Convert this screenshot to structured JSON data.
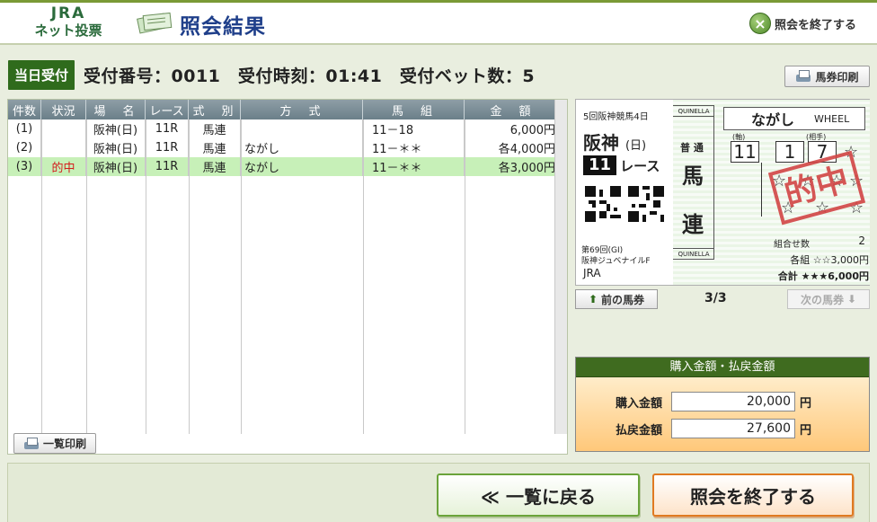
{
  "header": {
    "logo_line1": "JRA",
    "logo_line2": "ネット投票",
    "title": "照会結果",
    "end_label": "照会を終了する"
  },
  "info": {
    "today_badge": "当日受付",
    "text": "受付番号：0011　受付時刻：01:41　受付ベット数：5",
    "ticket_print_label": "馬券印刷"
  },
  "table": {
    "headers": [
      "件数",
      "状況",
      "場　名",
      "レース",
      "式　別",
      "方　式",
      "馬　組",
      "金　額"
    ],
    "rows": [
      {
        "no": "(1)",
        "status": "",
        "venue": "阪神(日)",
        "race": "11R",
        "bet_type": "馬連",
        "method": "",
        "combo": "11－18",
        "amount": "6,000円"
      },
      {
        "no": "(2)",
        "status": "",
        "venue": "阪神(日)",
        "race": "11R",
        "bet_type": "馬連",
        "method": "ながし",
        "combo": "11－＊＊",
        "amount": "各4,000円"
      },
      {
        "no": "(3)",
        "status": "的中",
        "venue": "阪神(日)",
        "race": "11R",
        "bet_type": "馬連",
        "method": "ながし",
        "combo": "11－＊＊",
        "amount": "各3,000円"
      }
    ],
    "list_print_label": "一覧印刷"
  },
  "ticket": {
    "meeting": "5回阪神競馬4日",
    "venue": "阪神",
    "day": "(日)",
    "race_no": "11",
    "race_label": "レース",
    "quinella_top": "QUINELLA",
    "quinella_bottom": "QUINELLA",
    "normal": "普 通",
    "type_char1": "馬",
    "type_char2": "連",
    "method_name": "ながし",
    "method_en": "WHEEL",
    "axis_label": "(軸)",
    "partner_label": "(相手)",
    "axis_no": "11",
    "partner1": "1",
    "partner2": "7",
    "stamp": "的中",
    "race_name1": "第69回(GI)",
    "race_name2": "阪神ジュベナイルF",
    "jra": "JRA",
    "combo_label": "組合せ数",
    "combo_count": "2",
    "each_line": "各組 ☆☆3,000円",
    "total_line": "合計 ★★★6,000円"
  },
  "nav": {
    "prev_label": "前の馬券",
    "next_label": "次の馬券",
    "pager": "3/3"
  },
  "amounts": {
    "title": "購入金額・払戻金額",
    "purchase_label": "購入金額",
    "purchase_value": "20,000",
    "refund_label": "払戻金額",
    "refund_value": "27,600",
    "unit": "円"
  },
  "footer": {
    "back_label": "≪ 一覧に戻る",
    "end_label": "照会を終了する"
  },
  "colors": {
    "hit_row": "#c7f0b8",
    "status_red": "#d31c1c",
    "brand_green": "#2f6b1c"
  }
}
